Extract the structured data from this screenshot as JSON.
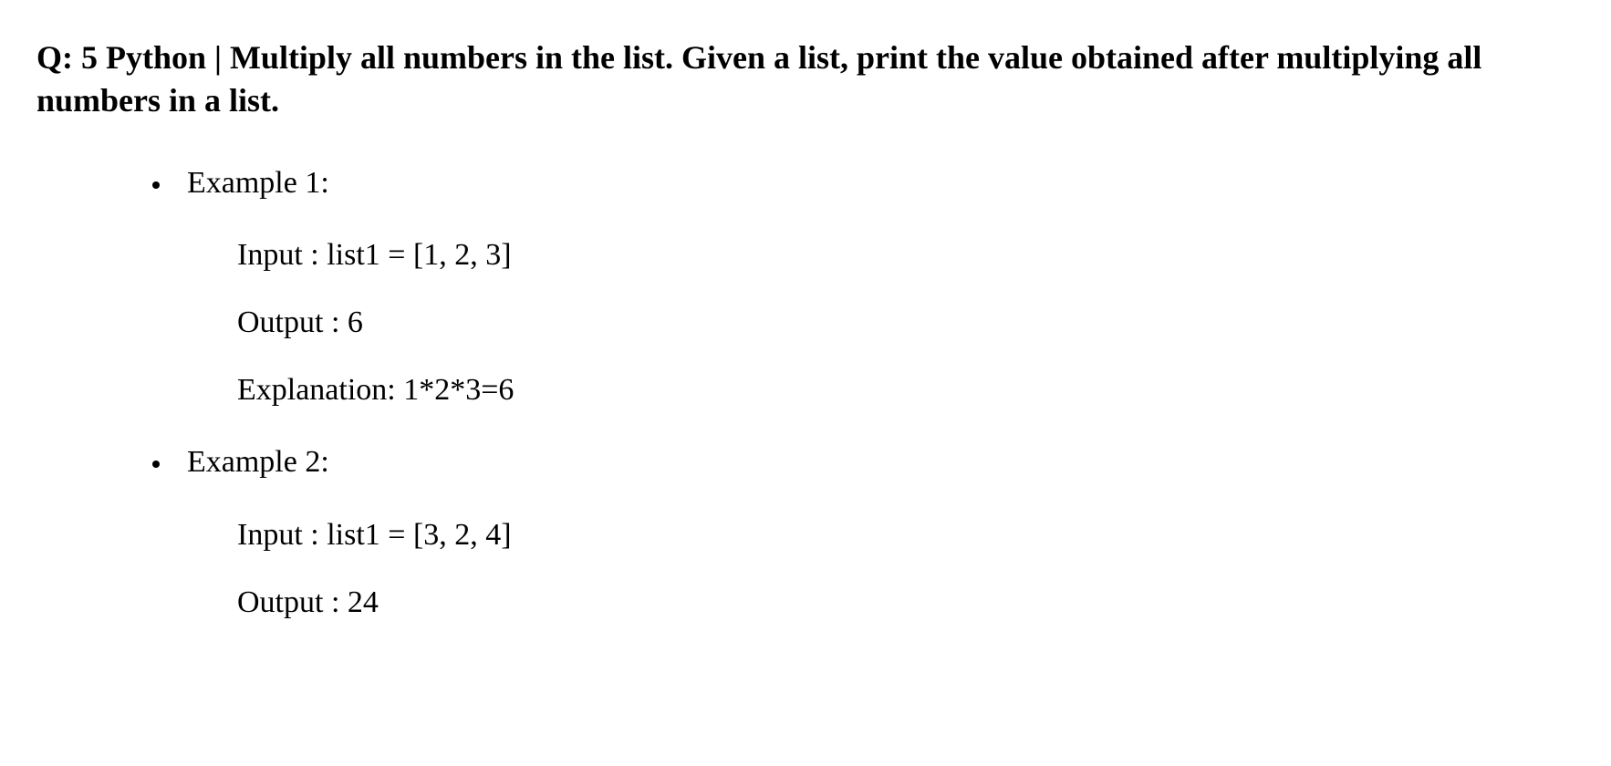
{
  "heading": "Q: 5 Python | Multiply all numbers in the list. Given a list, print the value obtained after multiplying all numbers in a list.",
  "examples": [
    {
      "label": "Example 1:",
      "lines": [
        "Input :  list1 = [1, 2, 3]",
        "Output : 6",
        "Explanation: 1*2*3=6"
      ]
    },
    {
      "label": "Example 2:",
      "lines": [
        "Input : list1 = [3, 2, 4]",
        "Output : 24"
      ]
    }
  ]
}
